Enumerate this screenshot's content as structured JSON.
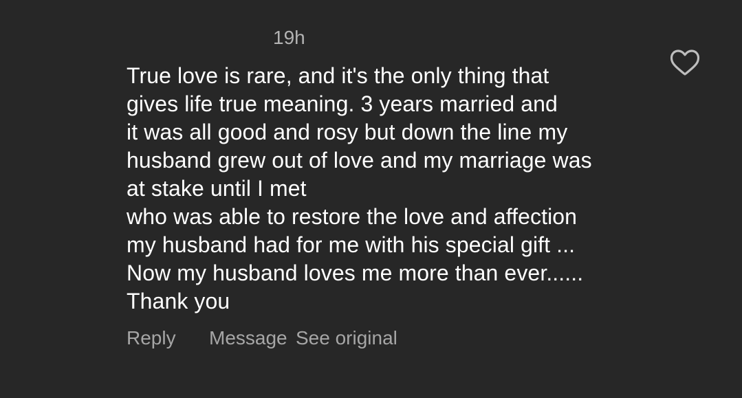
{
  "comment": {
    "timestamp": "19h",
    "lines": [
      "True love is rare, and it's the only thing that",
      "gives life true meaning. 3 years married and",
      "it was all good and rosy but down the line my",
      "husband grew out of love and my marriage was",
      "at stake until I met",
      "who was able to restore the love and affection",
      "my husband had for me with his special gift ...",
      "Now my husband loves me more than ever......",
      "Thank you"
    ],
    "like_icon": "heart-outline-icon",
    "actions": {
      "reply": "Reply",
      "message": "Message",
      "see_original": "See original"
    }
  },
  "colors": {
    "background": "#272727",
    "text": "#ffffff",
    "muted": "#a6a6a6"
  }
}
